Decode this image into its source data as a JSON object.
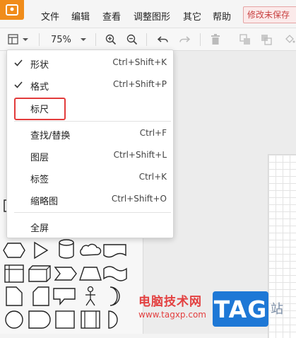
{
  "menubar": {
    "items": [
      "文件",
      "编辑",
      "查看",
      "调整图形",
      "其它",
      "帮助"
    ],
    "unsaved_label": "修改未保存"
  },
  "toolbar": {
    "zoom": "75%"
  },
  "view_menu": {
    "items": [
      {
        "label": "形状",
        "shortcut": "Ctrl+Shift+K",
        "checked": true
      },
      {
        "label": "格式",
        "shortcut": "Ctrl+Shift+P",
        "checked": true
      },
      {
        "label": "标尺",
        "shortcut": "",
        "checked": false
      },
      {
        "label": "查找/替换",
        "shortcut": "Ctrl+F",
        "checked": false
      },
      {
        "label": "图层",
        "shortcut": "Ctrl+Shift+L",
        "checked": false
      },
      {
        "label": "标签",
        "shortcut": "Ctrl+K",
        "checked": false
      },
      {
        "label": "缩略图",
        "shortcut": "Ctrl+Shift+O",
        "checked": false
      },
      {
        "label": "全屏",
        "shortcut": "",
        "checked": false
      }
    ]
  },
  "watermark": {
    "site_name": "电脑技术网",
    "url": "www.tagxp.com",
    "badge": "TAG",
    "suffix": "站"
  },
  "colors": {
    "brand": "#f08c1a",
    "highlight": "#e23b3b",
    "unsaved": "#c94141",
    "watermark_blue": "#1e78d6"
  }
}
